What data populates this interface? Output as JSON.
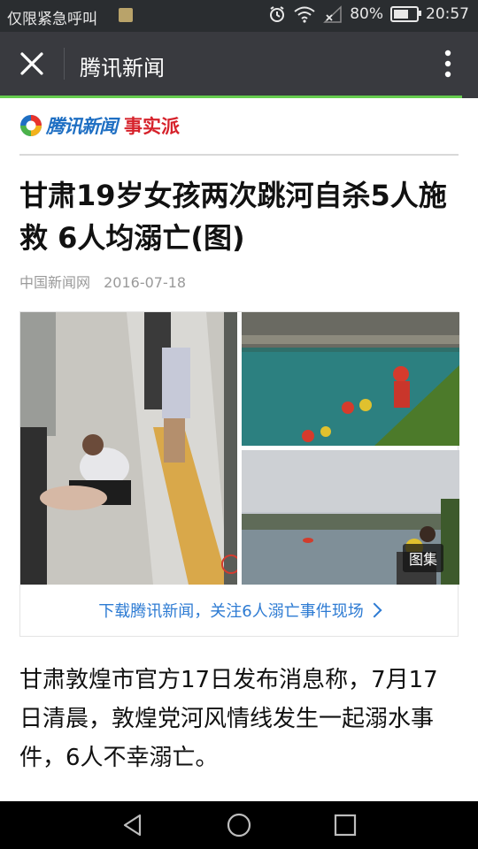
{
  "status_bar": {
    "carrier": "仅限紧急呼叫",
    "battery": "80%",
    "battery_level": 0.8,
    "time": "20:57",
    "icons": [
      "sim-card-icon",
      "alarm-icon",
      "wifi-icon",
      "signal-icon",
      "battery-icon"
    ]
  },
  "app_bar": {
    "title": "腾讯新闻",
    "close_icon": "close-icon",
    "more_icon": "more-vertical-icon"
  },
  "page_load_progress": 0.967,
  "article": {
    "logo_text": "腾讯新闻",
    "logo_sub": "事实派",
    "headline": "甘肃19岁女孩两次跳河自杀5人施救 6人均溺亡(图)",
    "source": "中国新闻网",
    "date": "2016-07-18",
    "gallery_badge": "图集",
    "gallery_link": "下载腾讯新闻，关注6人溺亡事件现场",
    "body": "甘肃敦煌市官方17日发布消息称，7月17日清晨，敦煌党河风情线发生一起溺水事件，6人不幸溺亡。"
  },
  "colors": {
    "status_bar": "#2a2d30",
    "app_bar": "#393a3f",
    "progress": "#65cc4e",
    "link": "#2d7bd3",
    "logo_blue": "#1f6fc3",
    "logo_red": "#d6222b"
  },
  "nav_bar": {
    "icons": [
      "back-icon",
      "home-icon",
      "recents-icon"
    ]
  }
}
